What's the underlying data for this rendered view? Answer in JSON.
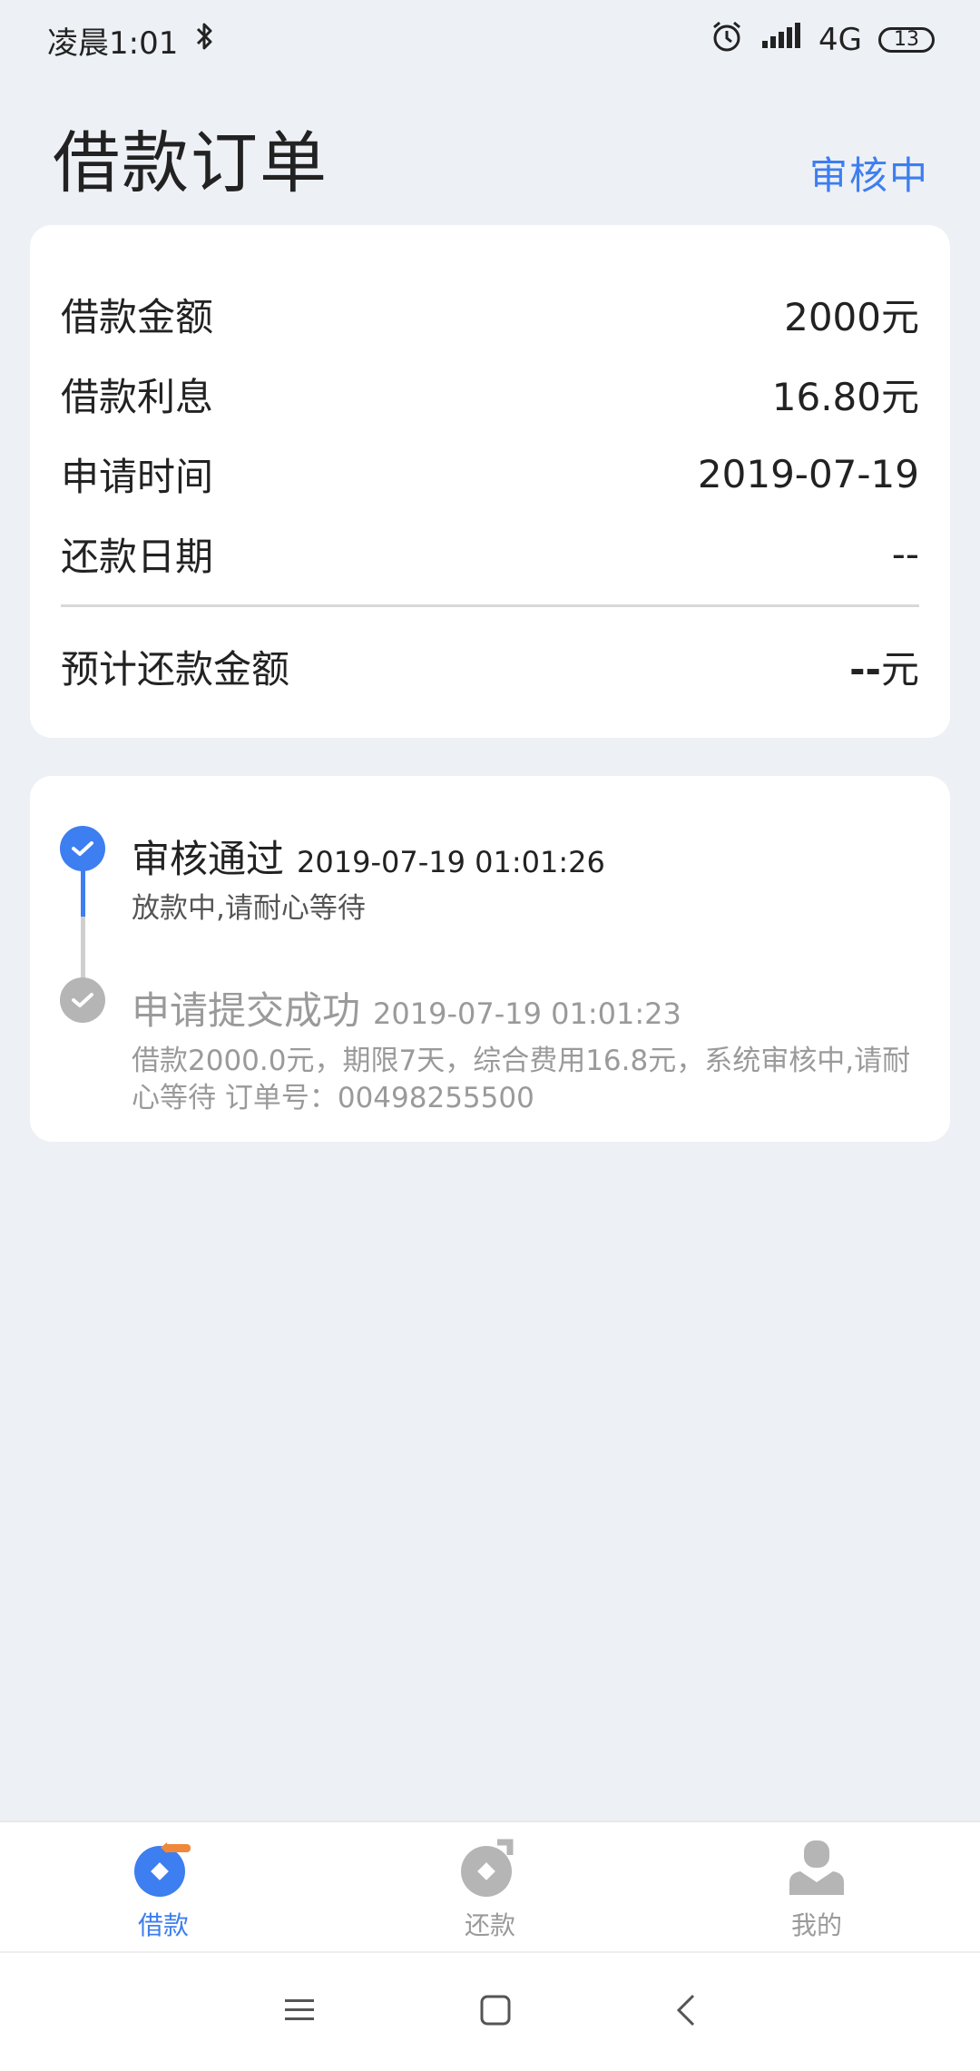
{
  "status_bar": {
    "time": "凌晨1:01",
    "network": "4G",
    "battery": "13"
  },
  "header": {
    "title": "借款订单",
    "status": "审核中"
  },
  "order": {
    "rows": [
      {
        "label": "借款金额",
        "value": "2000元"
      },
      {
        "label": "借款利息",
        "value": "16.80元"
      },
      {
        "label": "申请时间",
        "value": "2019-07-19"
      },
      {
        "label": "还款日期",
        "value": "--"
      }
    ],
    "total": {
      "label": "预计还款金额",
      "value_dash": "--",
      "value_unit": "元"
    }
  },
  "timeline": [
    {
      "title": "审核通过",
      "time": "2019-07-19 01:01:26",
      "desc_line1": "放款中,请耐心等待",
      "desc_line2": "",
      "active": true
    },
    {
      "title": "申请提交成功",
      "time": "2019-07-19 01:01:23",
      "desc_line1": "借款2000.0元，期限7天，综合费用16.8元，系统审核中,请耐",
      "desc_line2": "心等待 订单号：00498255500",
      "active": false
    }
  ],
  "tabs": [
    {
      "label": "借款",
      "active": true
    },
    {
      "label": "还款",
      "active": false
    },
    {
      "label": "我的",
      "active": false
    }
  ],
  "colors": {
    "accent": "#3d7ef0",
    "inactive": "#b5b5b5",
    "orange": "#f0883a"
  }
}
